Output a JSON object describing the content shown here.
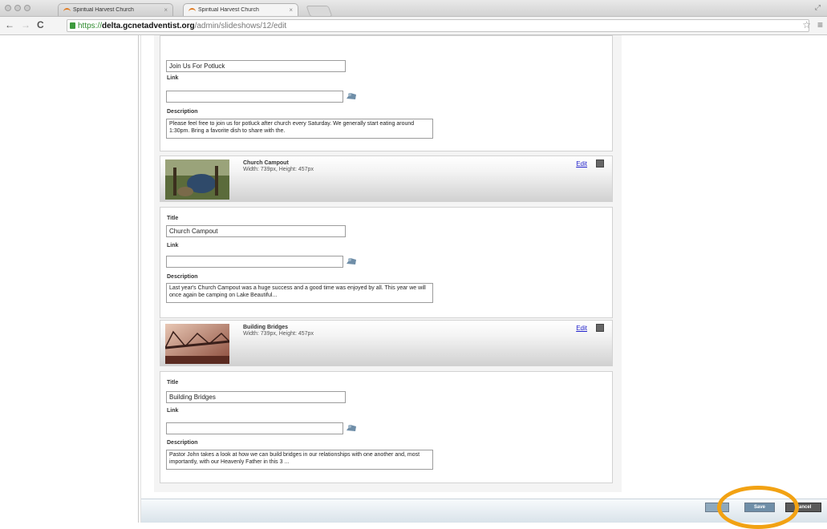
{
  "browser": {
    "tabs": [
      {
        "label": "Spiritual Harvest Church",
        "active": false
      },
      {
        "label": "Spiritual Harvest Church",
        "active": true
      }
    ],
    "url": {
      "scheme": "https://",
      "host": "delta.gcnetadventist.org",
      "path": "/admin/slideshows/12/edit"
    }
  },
  "labels": {
    "title": "Title",
    "link": "Link",
    "description": "Description",
    "edit": "Edit"
  },
  "slides": [
    {
      "title_value": "Join Us For Potluck",
      "link_value": "",
      "description": "Please feel free to join us for potluck after church every Saturday. We generally start eating around 1:30pm. Bring a favorite dish to share with the."
    },
    {
      "name": "Church Campout",
      "dims": "Width: 739px, Height: 457px",
      "title_value": "Church Campout",
      "link_value": "",
      "description": "Last year's Church Campout was a huge success and a good time was enjoyed by all. This year we will once again be camping on Lake Beautiful..."
    },
    {
      "name": "Building Bridges",
      "dims": "Width: 739px, Height: 457px",
      "title_value": "Building Bridges",
      "link_value": "",
      "description": "Pastor John takes a look at how we can build bridges in our relationships with one another and, most importantly, with our Heavenly Father in this 3 ..."
    }
  ],
  "footer": {
    "buttons": [
      "Save",
      "Cancel"
    ]
  },
  "colors": {
    "highlight": "#f2a213",
    "link": "#2222cc",
    "url_scheme": "#2e8b2e",
    "footer_button": "#6f8ea8"
  }
}
